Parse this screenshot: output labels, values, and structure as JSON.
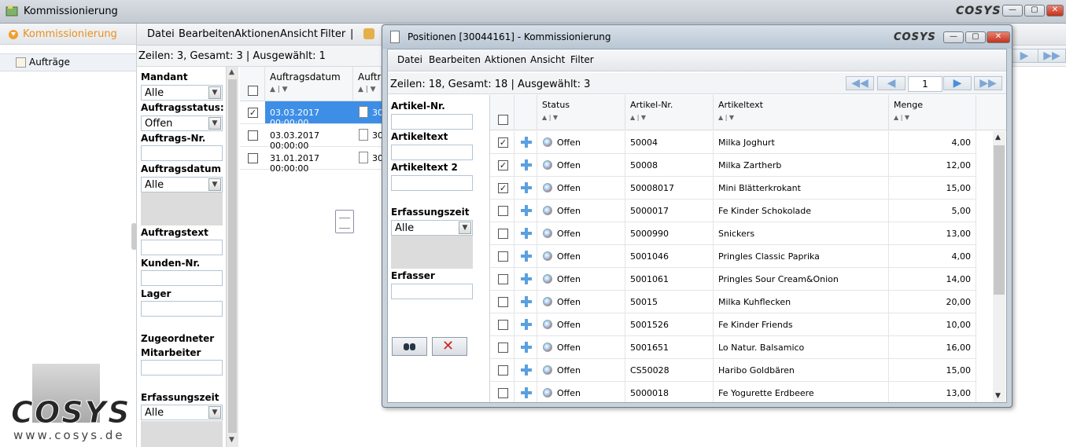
{
  "main_window": {
    "title": "Kommissionierung",
    "brand": "COSYS",
    "minimize": "—",
    "maximize": "▢",
    "close": "✕"
  },
  "nav": {
    "header": "Kommissionierung",
    "items": [
      {
        "label": "Aufträge"
      }
    ],
    "logo_text": "COSYS",
    "logo_url": "www.cosys.de"
  },
  "main_menu": [
    "Datei",
    "Bearbeiten",
    "Aktionen",
    "Ansicht",
    "Filter",
    "|"
  ],
  "main_status": "Zeilen: 3, Gesamt: 3  |  Ausgewählt: 1",
  "filter": {
    "mandant": {
      "label": "Mandant",
      "value": "Alle"
    },
    "auftragsstatus": {
      "label": "Auftragsstatus:",
      "value": "Offen"
    },
    "auftragsnr": {
      "label": "Auftrags-Nr.",
      "value": ""
    },
    "auftragsdatum": {
      "label": "Auftragsdatum",
      "value": "Alle"
    },
    "auftragstext": {
      "label": "Auftragstext",
      "value": ""
    },
    "kundennr": {
      "label": "Kunden-Nr.",
      "value": ""
    },
    "lager": {
      "label": "Lager",
      "value": ""
    },
    "mitarbeiter_1": {
      "label": "Zugeordneter"
    },
    "mitarbeiter_2": {
      "label": "Mitarbeiter",
      "value": ""
    },
    "erfassungszeit": {
      "label": "Erfassungszeit",
      "value": "Alle"
    }
  },
  "main_table": {
    "columns": [
      "Auftragsdatum",
      "Auftrag"
    ],
    "sort": "▲ | ▼",
    "rows": [
      {
        "date": "03.03.2017 00:00:00",
        "nr": "300",
        "checked": true,
        "selected": true
      },
      {
        "date": "03.03.2017 00:00:00",
        "nr": "300",
        "checked": false,
        "selected": false
      },
      {
        "date": "31.01.2017 00:00:00",
        "nr": "300",
        "checked": false,
        "selected": false
      }
    ]
  },
  "dialog": {
    "title": "Positionen [30044161] - Kommissionierung",
    "brand": "COSYS",
    "menu": [
      "Datei",
      "Bearbeiten",
      "Aktionen",
      "Ansicht",
      "Filter"
    ],
    "status": "Zeilen: 18, Gesamt: 18  |  Ausgewählt: 3",
    "page": "1",
    "pager": {
      "first": "◀◀",
      "prev": "◀",
      "next": "▶",
      "last": "▶▶"
    },
    "filter": {
      "artikelnr": {
        "label": "Artikel-Nr.",
        "value": ""
      },
      "artikeltext": {
        "label": "Artikeltext",
        "value": ""
      },
      "artikeltext2": {
        "label": "Artikeltext 2",
        "value": ""
      },
      "erfassungszeit": {
        "label": "Erfassungszeit",
        "value": "Alle"
      },
      "erfasser": {
        "label": "Erfasser",
        "value": ""
      }
    },
    "grid": {
      "columns": [
        "Status",
        "Artikel-Nr.",
        "Artikeltext",
        "Menge"
      ],
      "sort": "▲ | ▼",
      "rows": [
        {
          "checked": true,
          "status": "Offen",
          "nr": "50004",
          "text": "Milka Joghurt",
          "menge": "4,00"
        },
        {
          "checked": true,
          "status": "Offen",
          "nr": "50008",
          "text": "Milka Zartherb",
          "menge": "12,00"
        },
        {
          "checked": true,
          "status": "Offen",
          "nr": "50008017",
          "text": "Mini Blätterkrokant",
          "menge": "15,00"
        },
        {
          "checked": false,
          "status": "Offen",
          "nr": "5000017",
          "text": "Fe Kinder Schokolade",
          "menge": "5,00"
        },
        {
          "checked": false,
          "status": "Offen",
          "nr": "5000990",
          "text": "Snickers",
          "menge": "13,00"
        },
        {
          "checked": false,
          "status": "Offen",
          "nr": "5001046",
          "text": "Pringles Classic Paprika",
          "menge": "4,00"
        },
        {
          "checked": false,
          "status": "Offen",
          "nr": "5001061",
          "text": "Pringles Sour Cream&Onion",
          "menge": "14,00"
        },
        {
          "checked": false,
          "status": "Offen",
          "nr": "50015",
          "text": "Milka Kuhflecken",
          "menge": "20,00"
        },
        {
          "checked": false,
          "status": "Offen",
          "nr": "5001526",
          "text": "Fe Kinder Friends",
          "menge": "10,00"
        },
        {
          "checked": false,
          "status": "Offen",
          "nr": "5001651",
          "text": "Lo Natur. Balsamico",
          "menge": "16,00"
        },
        {
          "checked": false,
          "status": "Offen",
          "nr": "CS50028",
          "text": "Haribo Goldbären",
          "menge": "15,00"
        },
        {
          "checked": false,
          "status": "Offen",
          "nr": "5000018",
          "text": "Fe Yogurette Erdbeere",
          "menge": "13,00"
        }
      ]
    }
  },
  "icons": {
    "app": "app-icon",
    "nav_header": "chevron-down-icon",
    "nav_item": "orders-icon",
    "dialog": "document-icon",
    "search": "binoculars-icon",
    "clear": "red-x-icon",
    "move": "move-icon",
    "status": "status-globe-icon"
  },
  "colors": {
    "accent_orange": "#e8901b",
    "selection_blue": "#3d8ee6",
    "link_blue": "#5aa0e0"
  }
}
